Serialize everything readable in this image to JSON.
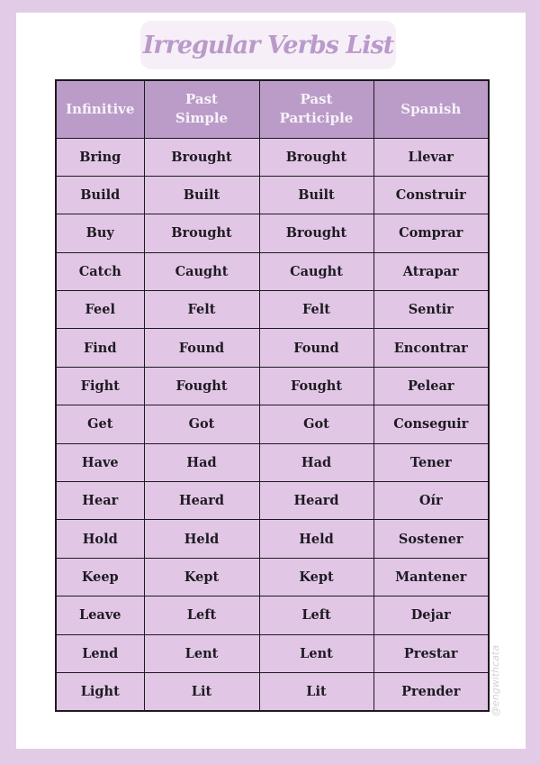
{
  "title": "Irregular Verbs List",
  "watermark": "@engwithcata",
  "colors": {
    "page_background": "#e2cbe6",
    "panel": "#ffffff",
    "title_box": "#f7eff8",
    "title_text": "#b99aca",
    "header_background": "#bb9cc8",
    "header_text": "#f8f2f9",
    "cell_background": "#e1c7e5",
    "cell_text": "#1e1a22",
    "border": "#1d1a1f"
  },
  "table": {
    "headers": [
      [
        "Infinitive"
      ],
      [
        "Past",
        "Simple"
      ],
      [
        "Past",
        "Participle"
      ],
      [
        "Spanish"
      ]
    ],
    "rows": [
      [
        "Bring",
        "Brought",
        "Brought",
        "Llevar"
      ],
      [
        "Build",
        "Built",
        "Built",
        "Construir"
      ],
      [
        "Buy",
        "Brought",
        "Brought",
        "Comprar"
      ],
      [
        "Catch",
        "Caught",
        "Caught",
        "Atrapar"
      ],
      [
        "Feel",
        "Felt",
        "Felt",
        "Sentir"
      ],
      [
        "Find",
        "Found",
        "Found",
        "Encontrar"
      ],
      [
        "Fight",
        "Fought",
        "Fought",
        "Pelear"
      ],
      [
        "Get",
        "Got",
        "Got",
        "Conseguir"
      ],
      [
        "Have",
        "Had",
        "Had",
        "Tener"
      ],
      [
        "Hear",
        "Heard",
        "Heard",
        "Oír"
      ],
      [
        "Hold",
        "Held",
        "Held",
        "Sostener"
      ],
      [
        "Keep",
        "Kept",
        "Kept",
        "Mantener"
      ],
      [
        "Leave",
        "Left",
        "Left",
        "Dejar"
      ],
      [
        "Lend",
        "Lent",
        "Lent",
        "Prestar"
      ],
      [
        "Light",
        "Lit",
        "Lit",
        "Prender"
      ]
    ]
  }
}
